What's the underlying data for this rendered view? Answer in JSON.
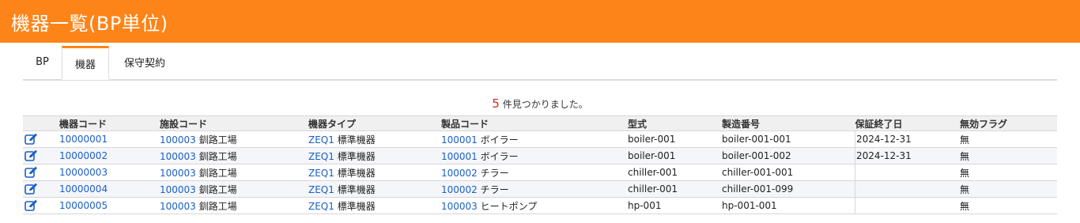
{
  "header": {
    "title": "機器一覧(BP単位)"
  },
  "tabs": [
    {
      "label": "BP"
    },
    {
      "label": "機器"
    },
    {
      "label": "保守契約"
    }
  ],
  "result": {
    "count": "5",
    "suffix": "件見つかりました。"
  },
  "table": {
    "columns": [
      "機器コード",
      "施設コード",
      "機器タイプ",
      "製品コード",
      "型式",
      "製造番号",
      "保証終了日",
      "無効フラグ"
    ],
    "rows": [
      {
        "code": "10000001",
        "facility_code": "100003",
        "facility_name": "釧路工場",
        "type_code": "ZEQ1",
        "type_name": "標準機器",
        "product_code": "100001",
        "product_name": "ボイラー",
        "model": "boiler-001",
        "serial": "boiler-001-001",
        "warranty_end": "2024-12-31",
        "invalid_flag": "無"
      },
      {
        "code": "10000002",
        "facility_code": "100003",
        "facility_name": "釧路工場",
        "type_code": "ZEQ1",
        "type_name": "標準機器",
        "product_code": "100001",
        "product_name": "ボイラー",
        "model": "boiler-001",
        "serial": "boiler-001-002",
        "warranty_end": "2024-12-31",
        "invalid_flag": "無"
      },
      {
        "code": "10000003",
        "facility_code": "100003",
        "facility_name": "釧路工場",
        "type_code": "ZEQ1",
        "type_name": "標準機器",
        "product_code": "100002",
        "product_name": "チラー",
        "model": "chiller-001",
        "serial": "chiller-001-001",
        "warranty_end": "",
        "invalid_flag": "無"
      },
      {
        "code": "10000004",
        "facility_code": "100003",
        "facility_name": "釧路工場",
        "type_code": "ZEQ1",
        "type_name": "標準機器",
        "product_code": "100002",
        "product_name": "チラー",
        "model": "chiller-001",
        "serial": "chiller-001-099",
        "warranty_end": "",
        "invalid_flag": "無"
      },
      {
        "code": "10000005",
        "facility_code": "100003",
        "facility_name": "釧路工場",
        "type_code": "ZEQ1",
        "type_name": "標準機器",
        "product_code": "100003",
        "product_name": "ヒートポンプ",
        "model": "hp-001",
        "serial": "hp-001-001",
        "warranty_end": "",
        "invalid_flag": "無"
      }
    ]
  },
  "icons": {
    "edit": "edit-icon"
  },
  "colors": {
    "header": "#fd8418",
    "link": "#1a5fc4",
    "count": "#d9241c"
  }
}
